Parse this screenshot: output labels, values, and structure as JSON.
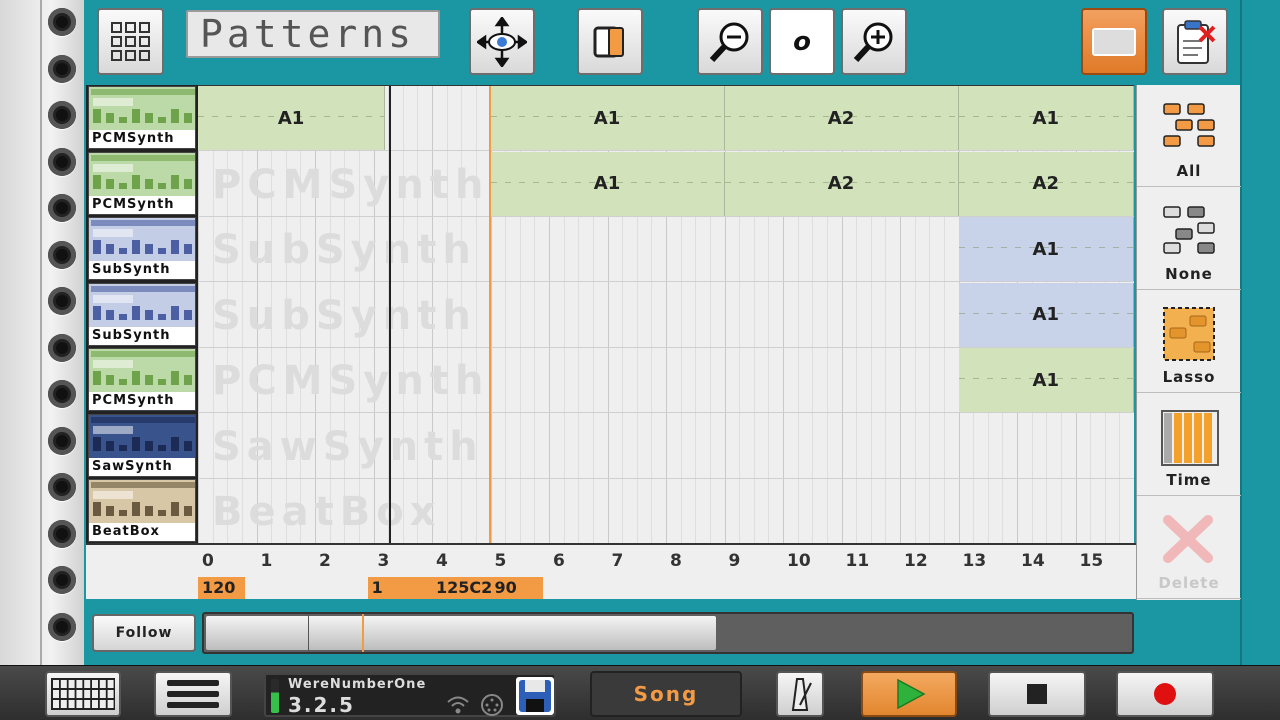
{
  "colors": {
    "frame": "#1b97a3",
    "accent": "#f39a45",
    "pattern_green": "#d2e3bc",
    "pattern_blue": "#c8d2e9"
  },
  "toolbar": {
    "mode_display": "Patterns",
    "grid_icon": "grid-icon",
    "move_icon": "move-eye-icon",
    "copy_icon": "copy-icon",
    "zoom_out_icon": "zoom-out-icon",
    "zoom_value": "o",
    "zoom_in_icon": "zoom-in-icon",
    "orange_icon": "window-icon",
    "clipboard_icon": "clipboard-delete-icon"
  },
  "tracks": [
    {
      "name": "PCMSynth",
      "thumb": "green"
    },
    {
      "name": "PCMSynth",
      "thumb": "green"
    },
    {
      "name": "SubSynth",
      "thumb": "blue"
    },
    {
      "name": "SubSynth",
      "thumb": "blue"
    },
    {
      "name": "PCMSynth",
      "thumb": "green"
    },
    {
      "name": "SawSynth",
      "thumb": "navy"
    },
    {
      "name": "BeatBox",
      "thumb": "tan"
    }
  ],
  "ghost_labels": [
    "",
    "PCMSynth",
    "SubSynth",
    "SubSynth",
    "PCMSynth",
    "SawSynth",
    "BeatBox"
  ],
  "patterns": [
    {
      "track": 0,
      "start": 0,
      "len": 3.2,
      "label": "A1",
      "color": "green"
    },
    {
      "track": 0,
      "start": 5,
      "len": 4,
      "label": "A1",
      "color": "green"
    },
    {
      "track": 0,
      "start": 9,
      "len": 4,
      "label": "A2",
      "color": "green"
    },
    {
      "track": 0,
      "start": 13,
      "len": 3,
      "label": "A1",
      "color": "green"
    },
    {
      "track": 1,
      "start": 5,
      "len": 4,
      "label": "A1",
      "color": "green"
    },
    {
      "track": 1,
      "start": 9,
      "len": 4,
      "label": "A2",
      "color": "green"
    },
    {
      "track": 1,
      "start": 13,
      "len": 3,
      "label": "A2",
      "color": "green"
    },
    {
      "track": 2,
      "start": 13,
      "len": 3,
      "label": "A1",
      "color": "blue"
    },
    {
      "track": 3,
      "start": 13,
      "len": 3,
      "label": "A1",
      "color": "blue"
    },
    {
      "track": 4,
      "start": 13,
      "len": 3,
      "label": "A1",
      "color": "green"
    }
  ],
  "ruler": {
    "ticks": [
      "0",
      "1",
      "2",
      "3",
      "4",
      "5",
      "6",
      "7",
      "8",
      "9",
      "10",
      "11",
      "12",
      "13",
      "14",
      "15"
    ],
    "tempos": [
      {
        "at": 0,
        "len": 0.8,
        "label": "120"
      },
      {
        "at": 2.9,
        "len": 0.3,
        "label": "1"
      },
      {
        "at": 3.2,
        "len": 0.8,
        "label": ""
      },
      {
        "at": 4.0,
        "len": 1.0,
        "label": "125C2"
      },
      {
        "at": 5.0,
        "len": 0.9,
        "label": "90"
      }
    ]
  },
  "tools": [
    {
      "label": "All",
      "icon": "select-all-icon"
    },
    {
      "label": "None",
      "icon": "select-none-icon"
    },
    {
      "label": "Lasso",
      "icon": "lasso-icon"
    },
    {
      "label": "Time",
      "icon": "time-select-icon"
    },
    {
      "label": "Delete",
      "icon": "delete-icon"
    }
  ],
  "follow_label": "Follow",
  "scroll": {
    "position": 0.55
  },
  "bottom": {
    "user": "WereNumberOne",
    "version": "3.2.5",
    "song_label": "Song"
  }
}
